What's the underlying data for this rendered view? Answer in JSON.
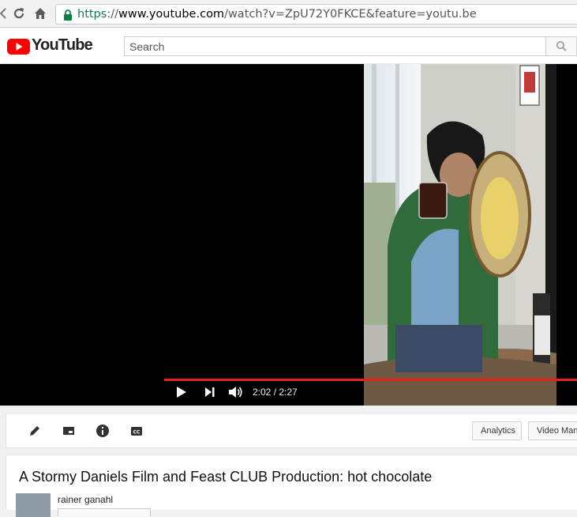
{
  "browser": {
    "url_scheme": "https",
    "url_sep": "://",
    "url_host": "www.youtube.com",
    "url_path": "/watch?v=ZpU72Y0FKCE&feature=youtu.be",
    "icons": [
      "back-arrow-icon",
      "reload-icon",
      "home-icon",
      "lock-icon"
    ]
  },
  "header": {
    "logo_text": "YouTube",
    "search_placeholder": "Search",
    "logo_color": "#ff0000"
  },
  "player": {
    "time": "2:02 / 2:27",
    "progress": 0.83,
    "progress_color": "#e62117",
    "icons": [
      "play-icon",
      "next-icon",
      "volume-icon"
    ]
  },
  "toolbar": {
    "analytics_label": "Analytics",
    "video_manager_label": "Video Mana",
    "icons": [
      "edit-icon",
      "enhance-icon",
      "info-icon",
      "cc-icon"
    ]
  },
  "video": {
    "title": "A Stormy Daniels Film and Feast CLUB Production: hot chocolate",
    "channel": "rainer ganahl"
  }
}
